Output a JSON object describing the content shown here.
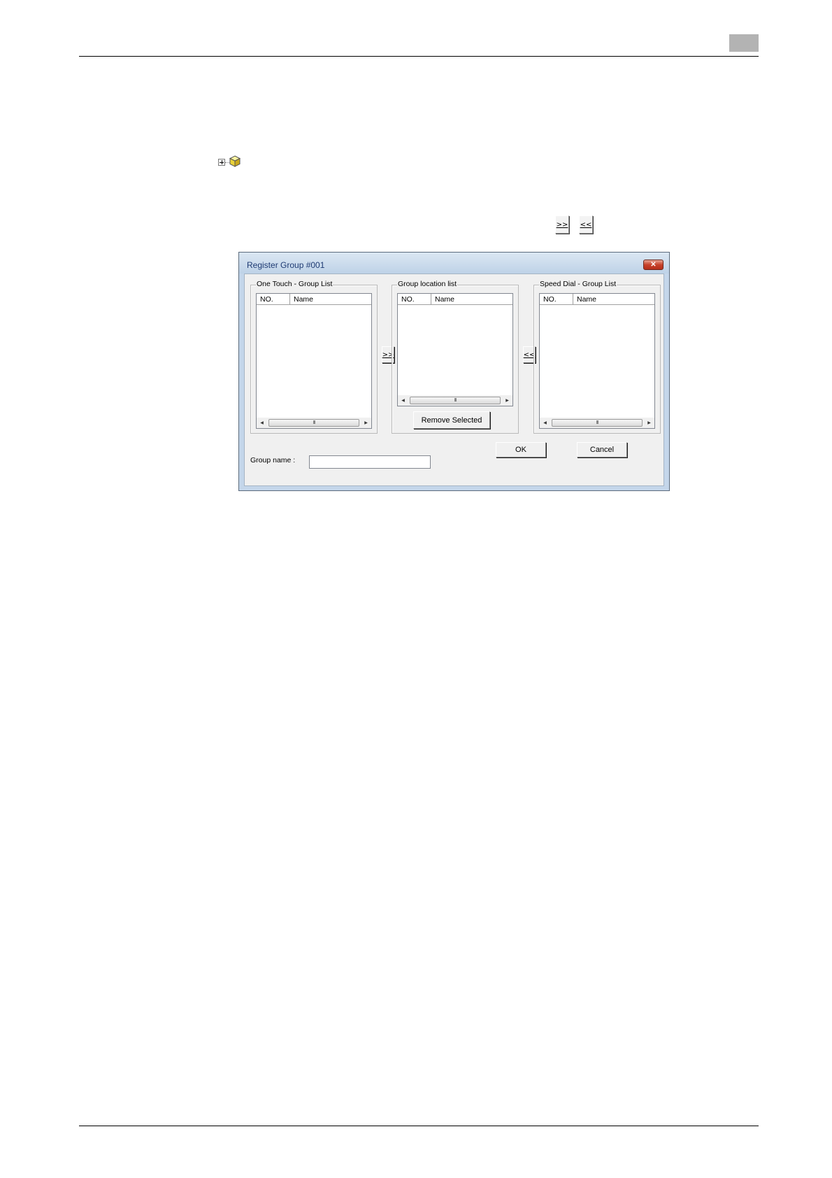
{
  "tree": {
    "expander_icon": "plus-box-icon",
    "node_icon": "yellow-cube-icon"
  },
  "standalone_buttons": {
    "add_label": ">>",
    "remove_label": "<<"
  },
  "dialog": {
    "title": "Register Group #001",
    "close_icon": "close-icon",
    "one_touch": {
      "label": "One Touch - Group List",
      "col_no": "NO.",
      "col_name": "Name",
      "scroll_grip": "III"
    },
    "group_location": {
      "label": "Group location list",
      "col_no": "NO.",
      "col_name": "Name",
      "scroll_grip": "III",
      "remove_button": "Remove Selected"
    },
    "speed_dial": {
      "label": "Speed Dial - Group List",
      "col_no": "NO.",
      "col_name": "Name",
      "scroll_grip": "III"
    },
    "add_button": ">>",
    "remove_button": "<<",
    "group_name_label": "Group name :",
    "group_name_value": "",
    "ok_button": "OK",
    "cancel_button": "Cancel"
  },
  "colors": {
    "title_text": "#1e3a73",
    "frame": "#c4d6ea",
    "close": "#c7422a",
    "page_tab": "#b3b3b3"
  }
}
